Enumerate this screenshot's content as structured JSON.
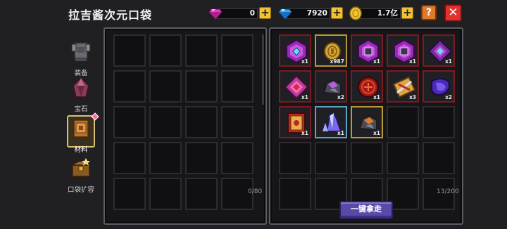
{
  "header": {
    "title": "拉吉酱次元口袋",
    "gems": "0",
    "diamonds": "7920",
    "gold": "1.7亿",
    "plus_label": "+",
    "help_label": "?",
    "close_label": "✕"
  },
  "tabs": [
    {
      "label": "装备",
      "icon": "armor-icon"
    },
    {
      "label": "宝石",
      "icon": "gem-icon"
    },
    {
      "label": "材料",
      "icon": "material-icon",
      "active": true
    },
    {
      "label": "口袋扩容",
      "icon": "chest-icon"
    }
  ],
  "left_panel": {
    "capacity": "0/80"
  },
  "right_panel": {
    "capacity": "13/200",
    "take_all_label": "一键拿走",
    "items": [
      {
        "icon": "purple-hexagon-gem-icon",
        "count": "x1",
        "frame": "red"
      },
      {
        "icon": "gold-coin-icon",
        "count": "x987",
        "frame": "gold"
      },
      {
        "icon": "purple-hexagon-rune-icon",
        "count": "x1",
        "frame": "red"
      },
      {
        "icon": "purple-hexagon-rune-icon",
        "count": "x1",
        "frame": "red"
      },
      {
        "icon": "purple-diamond-icon",
        "count": "x1",
        "frame": "red"
      },
      {
        "icon": "pink-diamond-icon",
        "count": "x1",
        "frame": "red"
      },
      {
        "icon": "purple-ore-icon",
        "count": "x2",
        "frame": "red"
      },
      {
        "icon": "red-seal-icon",
        "count": "x1",
        "frame": "red"
      },
      {
        "icon": "weapon-scroll-icon",
        "count": "x3",
        "frame": "red"
      },
      {
        "icon": "purple-knot-icon",
        "count": "x2",
        "frame": "red"
      },
      {
        "icon": "red-book-icon",
        "count": "x1",
        "frame": "red"
      },
      {
        "icon": "blue-crystal-icon",
        "count": "x1",
        "frame": "blue"
      },
      {
        "icon": "orange-ore-icon",
        "count": "x1",
        "frame": "gold"
      }
    ]
  },
  "colors": {
    "gem_pink": "#e040c0",
    "diamond_blue": "#3aa8f0",
    "gold": "#f2c230",
    "button_purple": "#5a4aa8"
  }
}
